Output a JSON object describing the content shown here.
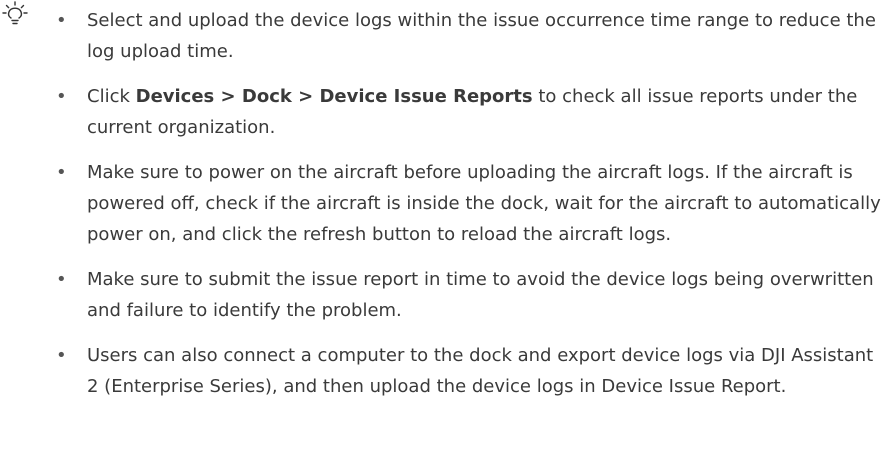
{
  "tips": {
    "icon": "lightbulb-icon",
    "items": [
      {
        "text": "Select and upload the device logs within the issue occurrence time range to reduce the log upload time."
      },
      {
        "prefix": "Click ",
        "path_1": "Devices",
        "sep_1": " > ",
        "path_2": "Dock",
        "sep_2": " > ",
        "path_3": "Device Issue Reports",
        "suffix": " to check all issue reports under the current organization."
      },
      {
        "text": "Make sure to power on the aircraft before uploading the aircraft logs. If the aircraft is powered off, check if the aircraft is inside the dock, wait for the aircraft to automatically power on, and click the refresh button to reload the aircraft logs."
      },
      {
        "text": "Make sure to submit the issue report in time to avoid the device logs being overwritten and failure to identify the problem."
      },
      {
        "text": "Users can also connect a computer to the dock and export device logs via DJI Assistant 2 (Enterprise Series), and then upload the device logs in Device Issue Report."
      }
    ]
  }
}
